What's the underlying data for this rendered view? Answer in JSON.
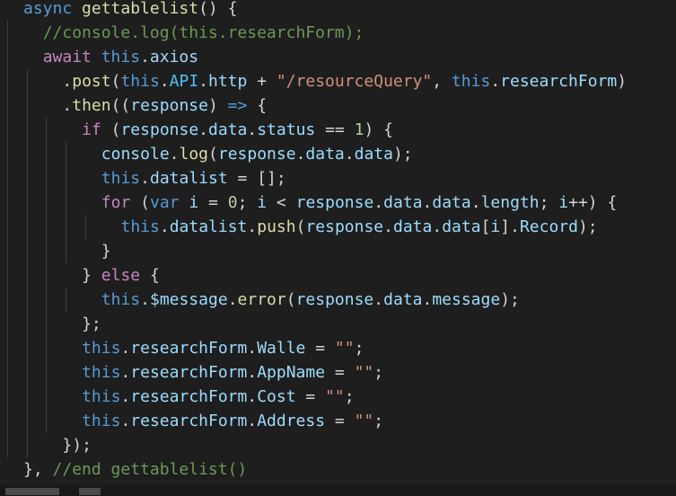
{
  "editor": {
    "lines": [
      {
        "indent": 1,
        "tokens": [
          [
            "async",
            "kw"
          ],
          [
            " ",
            "punc"
          ],
          [
            "gettablelist",
            "fn"
          ],
          [
            "() {",
            "punc"
          ]
        ]
      },
      {
        "indent": 2,
        "tokens": [
          [
            "//console.log(this.researchForm);",
            "com"
          ]
        ]
      },
      {
        "indent": 2,
        "tokens": [
          [
            "await",
            "ctrl"
          ],
          [
            " ",
            "punc"
          ],
          [
            "this",
            "kw"
          ],
          [
            ".",
            "punc"
          ],
          [
            "axios",
            "var"
          ]
        ]
      },
      {
        "indent": 3,
        "tokens": [
          [
            ".",
            "punc"
          ],
          [
            "post",
            "fn"
          ],
          [
            "(",
            "punc"
          ],
          [
            "this",
            "kw"
          ],
          [
            ".",
            "punc"
          ],
          [
            "API",
            "const"
          ],
          [
            ".",
            "punc"
          ],
          [
            "http",
            "var"
          ],
          [
            " + ",
            "punc"
          ],
          [
            "\"/resourceQuery\"",
            "str"
          ],
          [
            ", ",
            "punc"
          ],
          [
            "this",
            "kw"
          ],
          [
            ".",
            "punc"
          ],
          [
            "researchForm",
            "var"
          ],
          [
            ")",
            "punc"
          ]
        ]
      },
      {
        "indent": 3,
        "tokens": [
          [
            ".",
            "punc"
          ],
          [
            "then",
            "fn"
          ],
          [
            "((",
            "punc"
          ],
          [
            "response",
            "var"
          ],
          [
            ") ",
            "punc"
          ],
          [
            "=>",
            "kw"
          ],
          [
            " {",
            "punc"
          ]
        ]
      },
      {
        "indent": 4,
        "tokens": [
          [
            "if",
            "ctrl"
          ],
          [
            " (",
            "punc"
          ],
          [
            "response",
            "var"
          ],
          [
            ".",
            "punc"
          ],
          [
            "data",
            "var"
          ],
          [
            ".",
            "punc"
          ],
          [
            "status",
            "var"
          ],
          [
            " == ",
            "punc"
          ],
          [
            "1",
            "num"
          ],
          [
            ") {",
            "punc"
          ]
        ]
      },
      {
        "indent": 5,
        "tokens": [
          [
            "console",
            "var"
          ],
          [
            ".",
            "punc"
          ],
          [
            "log",
            "fn"
          ],
          [
            "(",
            "punc"
          ],
          [
            "response",
            "var"
          ],
          [
            ".",
            "punc"
          ],
          [
            "data",
            "var"
          ],
          [
            ".",
            "punc"
          ],
          [
            "data",
            "var"
          ],
          [
            ");",
            "punc"
          ]
        ]
      },
      {
        "indent": 5,
        "tokens": [
          [
            "this",
            "kw"
          ],
          [
            ".",
            "punc"
          ],
          [
            "datalist",
            "var"
          ],
          [
            " = [];",
            "punc"
          ]
        ]
      },
      {
        "indent": 5,
        "tokens": [
          [
            "for",
            "ctrl"
          ],
          [
            " (",
            "punc"
          ],
          [
            "var",
            "kw"
          ],
          [
            " ",
            "punc"
          ],
          [
            "i",
            "var"
          ],
          [
            " = ",
            "punc"
          ],
          [
            "0",
            "num"
          ],
          [
            "; ",
            "punc"
          ],
          [
            "i",
            "var"
          ],
          [
            " < ",
            "punc"
          ],
          [
            "response",
            "var"
          ],
          [
            ".",
            "punc"
          ],
          [
            "data",
            "var"
          ],
          [
            ".",
            "punc"
          ],
          [
            "data",
            "var"
          ],
          [
            ".",
            "punc"
          ],
          [
            "length",
            "var"
          ],
          [
            "; ",
            "punc"
          ],
          [
            "i",
            "var"
          ],
          [
            "++) {",
            "punc"
          ]
        ]
      },
      {
        "indent": 6,
        "tokens": [
          [
            "this",
            "kw"
          ],
          [
            ".",
            "punc"
          ],
          [
            "datalist",
            "var"
          ],
          [
            ".",
            "punc"
          ],
          [
            "push",
            "fn"
          ],
          [
            "(",
            "punc"
          ],
          [
            "response",
            "var"
          ],
          [
            ".",
            "punc"
          ],
          [
            "data",
            "var"
          ],
          [
            ".",
            "punc"
          ],
          [
            "data",
            "var"
          ],
          [
            "[",
            "punc"
          ],
          [
            "i",
            "var"
          ],
          [
            "].",
            "punc"
          ],
          [
            "Record",
            "var"
          ],
          [
            ");",
            "punc"
          ]
        ]
      },
      {
        "indent": 5,
        "tokens": [
          [
            "}",
            "punc"
          ]
        ]
      },
      {
        "indent": 4,
        "tokens": [
          [
            "} ",
            "punc"
          ],
          [
            "else",
            "ctrl"
          ],
          [
            " {",
            "punc"
          ]
        ]
      },
      {
        "indent": 5,
        "tokens": [
          [
            "this",
            "kw"
          ],
          [
            ".",
            "punc"
          ],
          [
            "$message",
            "var"
          ],
          [
            ".",
            "punc"
          ],
          [
            "error",
            "fn"
          ],
          [
            "(",
            "punc"
          ],
          [
            "response",
            "var"
          ],
          [
            ".",
            "punc"
          ],
          [
            "data",
            "var"
          ],
          [
            ".",
            "punc"
          ],
          [
            "message",
            "var"
          ],
          [
            ");",
            "punc"
          ]
        ]
      },
      {
        "indent": 4,
        "tokens": [
          [
            "};",
            "punc"
          ]
        ]
      },
      {
        "indent": 4,
        "tokens": [
          [
            "this",
            "kw"
          ],
          [
            ".",
            "punc"
          ],
          [
            "researchForm",
            "var"
          ],
          [
            ".",
            "punc"
          ],
          [
            "Walle",
            "var"
          ],
          [
            " = ",
            "punc"
          ],
          [
            "\"\"",
            "str"
          ],
          [
            ";",
            "punc"
          ]
        ]
      },
      {
        "indent": 4,
        "tokens": [
          [
            "this",
            "kw"
          ],
          [
            ".",
            "punc"
          ],
          [
            "researchForm",
            "var"
          ],
          [
            ".",
            "punc"
          ],
          [
            "AppName",
            "var"
          ],
          [
            " = ",
            "punc"
          ],
          [
            "\"\"",
            "str"
          ],
          [
            ";",
            "punc"
          ]
        ]
      },
      {
        "indent": 4,
        "tokens": [
          [
            "this",
            "kw"
          ],
          [
            ".",
            "punc"
          ],
          [
            "researchForm",
            "var"
          ],
          [
            ".",
            "punc"
          ],
          [
            "Cost",
            "var"
          ],
          [
            " = ",
            "punc"
          ],
          [
            "\"\"",
            "str"
          ],
          [
            ";",
            "punc"
          ]
        ]
      },
      {
        "indent": 4,
        "tokens": [
          [
            "this",
            "kw"
          ],
          [
            ".",
            "punc"
          ],
          [
            "researchForm",
            "var"
          ],
          [
            ".",
            "punc"
          ],
          [
            "Address",
            "var"
          ],
          [
            " = ",
            "punc"
          ],
          [
            "\"\"",
            "str"
          ],
          [
            ";",
            "punc"
          ]
        ]
      },
      {
        "indent": 3,
        "tokens": [
          [
            "});",
            "punc"
          ]
        ]
      },
      {
        "indent": 1,
        "tokens": [
          [
            "}, ",
            "punc"
          ],
          [
            "//end gettablelist()",
            "com"
          ]
        ]
      }
    ]
  },
  "colors": {
    "background": "#1e1e1e",
    "keyword": "#569cd6",
    "control": "#c586c0",
    "function": "#dcdcaa",
    "variable": "#9cdcfe",
    "string": "#ce9178",
    "number": "#b5cea8",
    "comment": "#6a9955",
    "constant": "#4fc1ff"
  }
}
